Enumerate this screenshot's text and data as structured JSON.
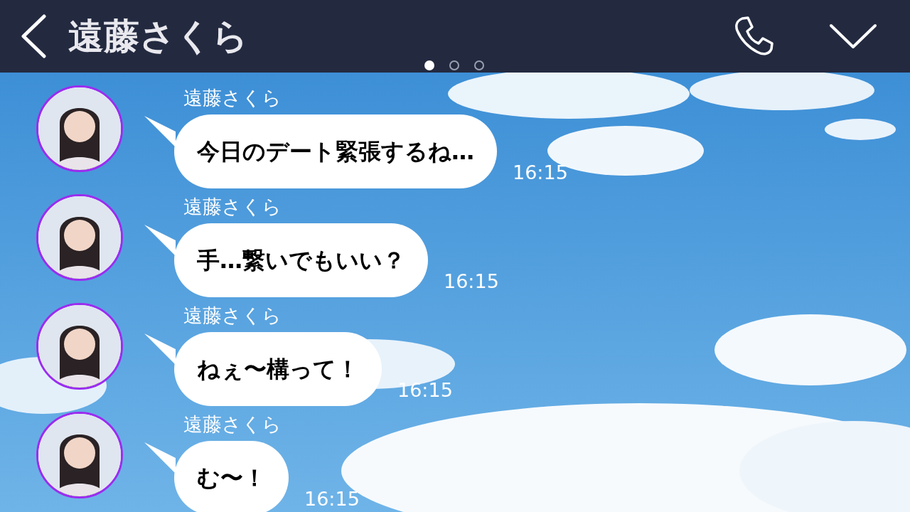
{
  "header": {
    "title": "遠藤さくら"
  },
  "page_dots": [
    {
      "selected": true
    },
    {
      "selected": false
    },
    {
      "selected": false
    }
  ],
  "messages": [
    {
      "sender": "遠藤さくら",
      "text": "今日のデート緊張するね…",
      "time": "16:15"
    },
    {
      "sender": "遠藤さくら",
      "text": "手…繋いでもいい？",
      "time": "16:15"
    },
    {
      "sender": "遠藤さくら",
      "text": "ねぇ〜構って！",
      "time": "16:15"
    },
    {
      "sender": "遠藤さくら",
      "text": "む〜！",
      "time": "16:15"
    }
  ]
}
